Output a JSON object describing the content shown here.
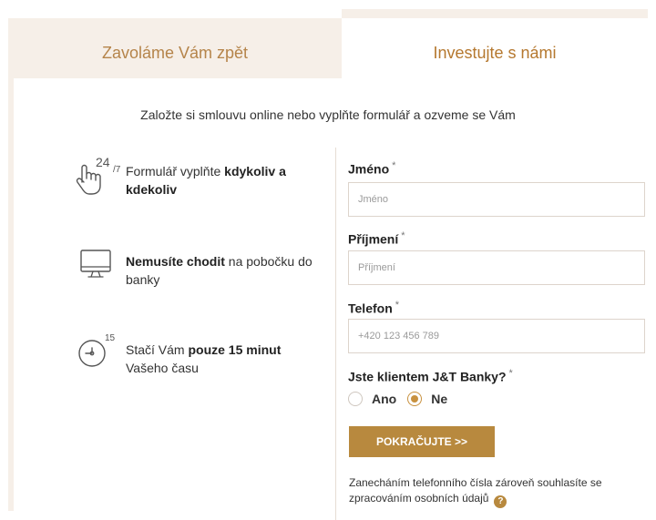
{
  "tabs": [
    {
      "label": "Zavoláme Vám zpět",
      "active": false
    },
    {
      "label": "Investujte s námi",
      "active": true
    }
  ],
  "intro": "Založte si smlouvu online nebo vyplňte formulář a ozveme se Vám",
  "features": [
    {
      "icon": "hand-pointer-icon",
      "sup": "24",
      "sub": "/7",
      "text_plain": "Formulář vyplňte ",
      "text_bold": "kdykoliv a kdekoliv",
      "text_after": ""
    },
    {
      "icon": "monitor-icon",
      "text_plain": "",
      "text_bold": "Nemusíte chodit",
      "text_after": " na pobočku do banky"
    },
    {
      "icon": "clock-icon",
      "sup": "15",
      "text_plain": "Stačí Vám ",
      "text_bold": "pouze 15 minut",
      "text_after": " Vašeho času"
    }
  ],
  "form": {
    "name_label": "Jméno",
    "name_placeholder": "Jméno",
    "surname_label": "Příjmení",
    "surname_placeholder": "Příjmení",
    "phone_label": "Telefon",
    "phone_placeholder": "+420 123 456 789",
    "client_label": "Jste klientem J&T Banky?",
    "required_mark": "*",
    "options": {
      "yes": "Ano",
      "no": "Ne"
    },
    "selected": "no"
  },
  "submit_label": "POKRAČUJTE >>",
  "consent_text": "Zanecháním telefonního čísla zároveň souhlasíte se zpracováním osobních údajů",
  "help_glyph": "?",
  "colors": {
    "accent": "#b8893e",
    "tab_bg": "#f6efe8",
    "tab_text": "#b5844a"
  }
}
